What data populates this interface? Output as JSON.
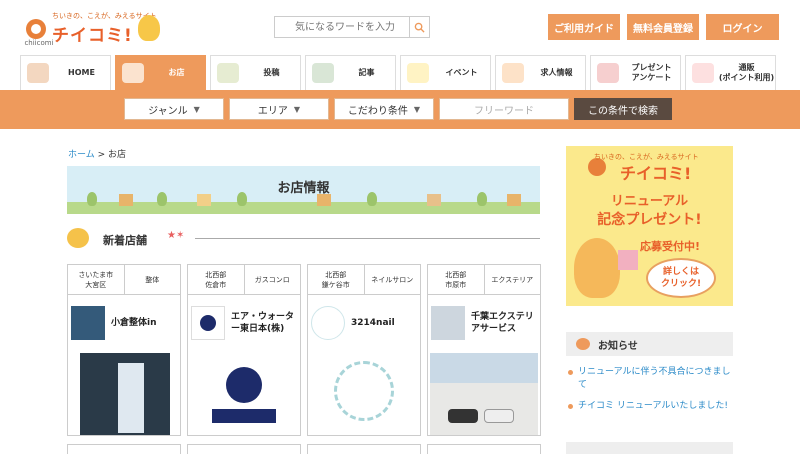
{
  "header": {
    "logo_tagline": "ちいきの、こえが、みえるサイト",
    "logo_brand": "チイコミ!",
    "logo_sub": "chiicomi",
    "search_placeholder": "気になるワードを入力",
    "guide_label": "ご利用ガイド",
    "register_label": "無料会員登録",
    "login_label": "ログイン"
  },
  "nav": {
    "items": [
      {
        "label": "HOME"
      },
      {
        "label": "お店"
      },
      {
        "label": "投稿"
      },
      {
        "label": "記事"
      },
      {
        "label": "イベント"
      },
      {
        "label": "求人情報"
      },
      {
        "label": "プレゼント\nアンケート"
      },
      {
        "label": "通販\n(ポイント利用)"
      }
    ],
    "active_index": 1
  },
  "filters": {
    "genre": "ジャンル",
    "area": "エリア",
    "conditions": "こだわり条件",
    "freeword_placeholder": "フリーワード",
    "submit": "この条件で検索"
  },
  "breadcrumb": {
    "home": "ホーム",
    "separator": " > ",
    "current": "お店"
  },
  "main": {
    "banner_title": "お店情報",
    "section_title": "新着店舗",
    "cards": [
      {
        "area": "さいたま市\n大宮区",
        "category": "整体",
        "name": "小倉整体in"
      },
      {
        "area": "北西部\n佐倉市",
        "category": "ガスコンロ",
        "name": "エア・ウォータ\nー東日本(株)"
      },
      {
        "area": "北西部\n鎌ケ谷市",
        "category": "ネイルサロン",
        "name": "3214nail"
      },
      {
        "area": "北西部\n市原市",
        "category": "エクステリア",
        "name": "千葉エクステリ\nアサービス"
      }
    ]
  },
  "sidebar": {
    "banner": {
      "tagline": "ちいきの、こえが、みえるサイト",
      "brand": "チイコミ!",
      "line1": "リニューアル",
      "line2": "記念プレゼント!",
      "line3": "応募受付中!",
      "bubble": "詳しくは\nクリック!"
    },
    "news_title": "お知らせ",
    "news": [
      "リニューアルに伴う不具合につきまして",
      "チイコミ リニューアルいたしました!"
    ]
  },
  "colors": {
    "accent": "#ee9a5c",
    "link": "#2a8ac8",
    "dark_button": "#5a4a40"
  }
}
